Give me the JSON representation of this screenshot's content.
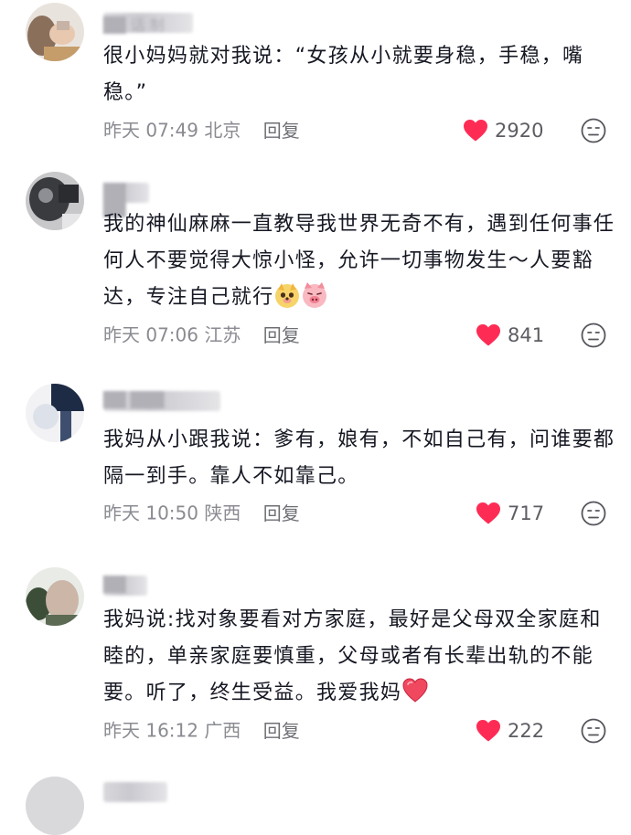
{
  "comments": [
    {
      "username": "██ 话 制",
      "text": "很小妈妈就对我说：“女孩从小就要身稳，手稳，嘴稳。”",
      "time": "昨天 07:49",
      "location": "北京",
      "reply_label": "回复",
      "likes": "2920"
    },
    {
      "username": "██ ██",
      "text": "我的神仙麻麻一直教导我世界无奇不有，遇到任何事任何人不要觉得大惊小怪，允许一切事物发生～人要豁达，专注自己就行",
      "time": "昨天 07:06",
      "location": "江苏",
      "reply_label": "回复",
      "likes": "841"
    },
    {
      "username": "██ ███",
      "text": "我妈从小跟我说：爹有，娘有，不如自己有，问谁要都隔一到手。靠人不如靠己。",
      "time": "昨天 10:50",
      "location": "陕西",
      "reply_label": "回复",
      "likes": "717"
    },
    {
      "username": "██",
      "text": "我妈说:找对象要看对方家庭，最好是父母双全家庭和睦的，单亲家庭要慎重，父母或者有长辈出轨的不能要。听了，终生受益。我爱我妈",
      "time": "昨天 16:12",
      "location": "广西",
      "reply_label": "回复",
      "likes": "222"
    }
  ],
  "colors": {
    "like_heart": "#fe2c55",
    "meta_text": "#8a8b91",
    "body_text": "#161823"
  },
  "icons": {
    "like": "heart-icon",
    "dislike": "dislike-face-icon",
    "emoji_1": "dog-face-emoji-icon",
    "emoji_2": "pig-face-emoji-icon",
    "emoji_3": "red-heart-emoji-icon"
  }
}
